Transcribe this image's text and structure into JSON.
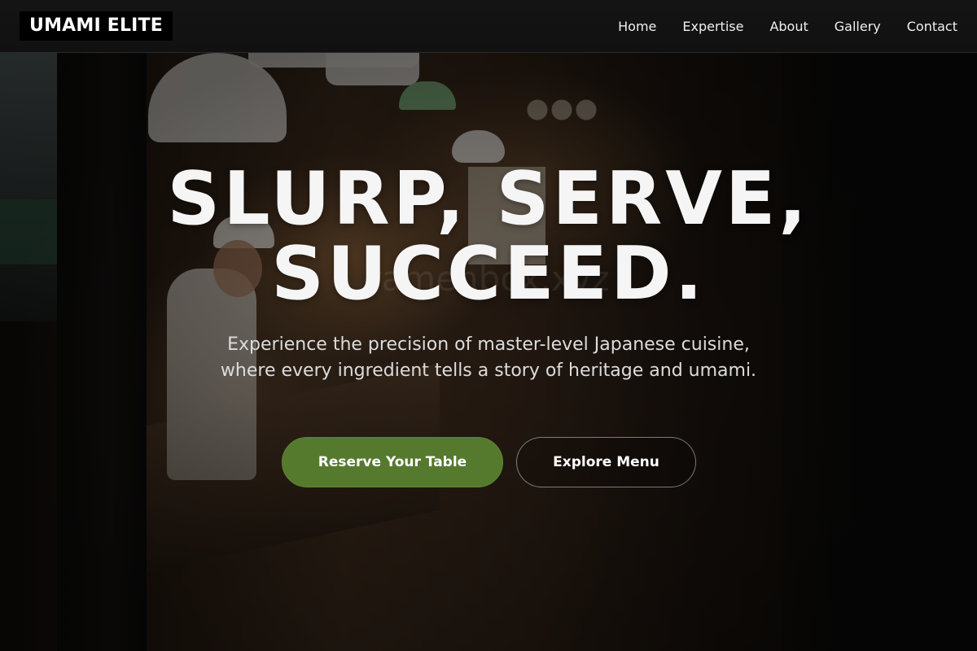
{
  "header": {
    "logo": "UMAMI ELITE",
    "nav": [
      "Home",
      "Expertise",
      "About",
      "Gallery",
      "Contact"
    ]
  },
  "hero": {
    "headline_line1": "SLURP, SERVE,",
    "headline_line2": "SUCCEED.",
    "subtitle": "Experience the precision of master-level Japanese cuisine, where every ingredient tells a story of heritage and umami.",
    "primary_cta": "Reserve Your Table",
    "secondary_cta": "Explore Menu",
    "watermark": "ramenbox.xyz"
  },
  "colors": {
    "primary_button": "#557a2e",
    "header_bg": "#121212",
    "text": "#f5f5f5"
  }
}
